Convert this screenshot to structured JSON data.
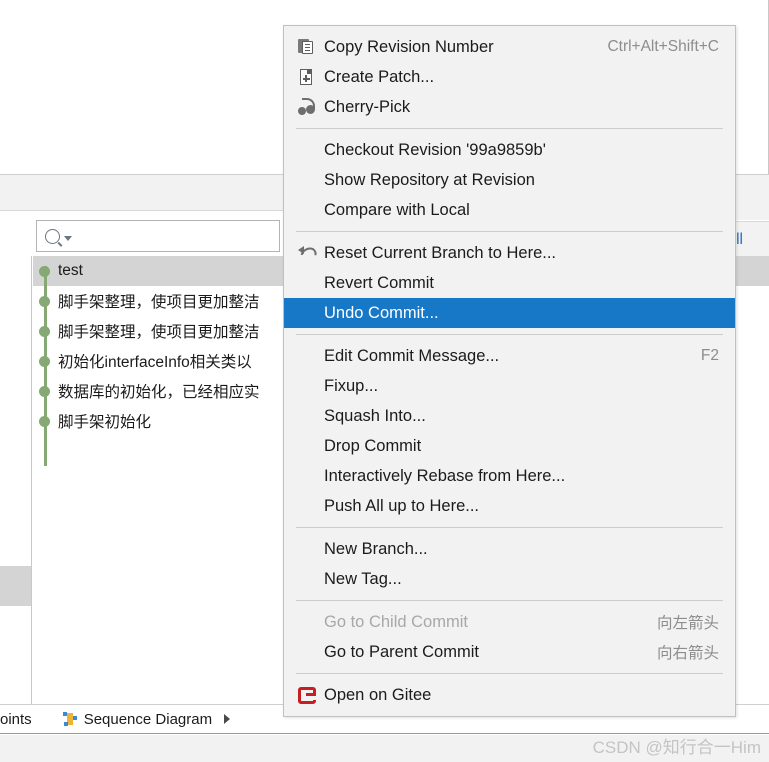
{
  "background": {
    "search": {
      "value": "",
      "placeholder": "",
      "icon": "search-icon"
    },
    "filter_label": ": All",
    "commits": [
      {
        "message": "test",
        "selected": true
      },
      {
        "message": "脚手架整理，使项目更加整洁",
        "selected": false
      },
      {
        "message": "脚手架整理，使项目更加整洁",
        "selected": false
      },
      {
        "message": "初始化interfaceInfo相关类以",
        "selected": false
      },
      {
        "message": "数据库的初始化，已经相应实",
        "selected": false
      },
      {
        "message": "脚手架初始化",
        "selected": false
      }
    ],
    "bottom_bar": {
      "breakpoints_label": "oints",
      "sequence_diagram_label": "Sequence Diagram"
    }
  },
  "context_menu": {
    "groups": [
      {
        "items": [
          {
            "label": "Copy Revision Number",
            "shortcut": "Ctrl+Alt+Shift+C",
            "icon": "copy-icon",
            "disabled": false,
            "highlighted": false
          },
          {
            "label": "Create Patch...",
            "shortcut": "",
            "icon": "patch-icon",
            "disabled": false,
            "highlighted": false
          },
          {
            "label": "Cherry-Pick",
            "shortcut": "",
            "icon": "cherry-icon",
            "disabled": false,
            "highlighted": false
          }
        ]
      },
      {
        "items": [
          {
            "label": "Checkout Revision '99a9859b'",
            "shortcut": "",
            "icon": "",
            "disabled": false,
            "highlighted": false
          },
          {
            "label": "Show Repository at Revision",
            "shortcut": "",
            "icon": "",
            "disabled": false,
            "highlighted": false
          },
          {
            "label": "Compare with Local",
            "shortcut": "",
            "icon": "",
            "disabled": false,
            "highlighted": false
          }
        ]
      },
      {
        "items": [
          {
            "label": "Reset Current Branch to Here...",
            "shortcut": "",
            "icon": "reset-icon",
            "disabled": false,
            "highlighted": false
          },
          {
            "label": "Revert Commit",
            "shortcut": "",
            "icon": "",
            "disabled": false,
            "highlighted": false
          },
          {
            "label": "Undo Commit...",
            "shortcut": "",
            "icon": "",
            "disabled": false,
            "highlighted": true
          }
        ]
      },
      {
        "items": [
          {
            "label": "Edit Commit Message...",
            "shortcut": "F2",
            "icon": "",
            "disabled": false,
            "highlighted": false
          },
          {
            "label": "Fixup...",
            "shortcut": "",
            "icon": "",
            "disabled": false,
            "highlighted": false
          },
          {
            "label": "Squash Into...",
            "shortcut": "",
            "icon": "",
            "disabled": false,
            "highlighted": false
          },
          {
            "label": "Drop Commit",
            "shortcut": "",
            "icon": "",
            "disabled": false,
            "highlighted": false
          },
          {
            "label": "Interactively Rebase from Here...",
            "shortcut": "",
            "icon": "",
            "disabled": false,
            "highlighted": false
          },
          {
            "label": "Push All up to Here...",
            "shortcut": "",
            "icon": "",
            "disabled": false,
            "highlighted": false
          }
        ]
      },
      {
        "items": [
          {
            "label": "New Branch...",
            "shortcut": "",
            "icon": "",
            "disabled": false,
            "highlighted": false
          },
          {
            "label": "New Tag...",
            "shortcut": "",
            "icon": "",
            "disabled": false,
            "highlighted": false
          }
        ]
      },
      {
        "items": [
          {
            "label": "Go to Child Commit",
            "shortcut": "向左箭头",
            "icon": "",
            "disabled": true,
            "highlighted": false
          },
          {
            "label": "Go to Parent Commit",
            "shortcut": "向右箭头",
            "icon": "",
            "disabled": false,
            "highlighted": false
          }
        ]
      },
      {
        "items": [
          {
            "label": "Open on Gitee",
            "shortcut": "",
            "icon": "gitee-icon",
            "disabled": false,
            "highlighted": false
          }
        ]
      }
    ]
  },
  "watermark": "CSDN @知行合一Him",
  "colors": {
    "highlight": "#1878c8",
    "menu_bg": "#f2f2f2",
    "graph_node": "#85a874",
    "gitee_red": "#c71d23",
    "filter_blue": "#2b6cb8"
  }
}
